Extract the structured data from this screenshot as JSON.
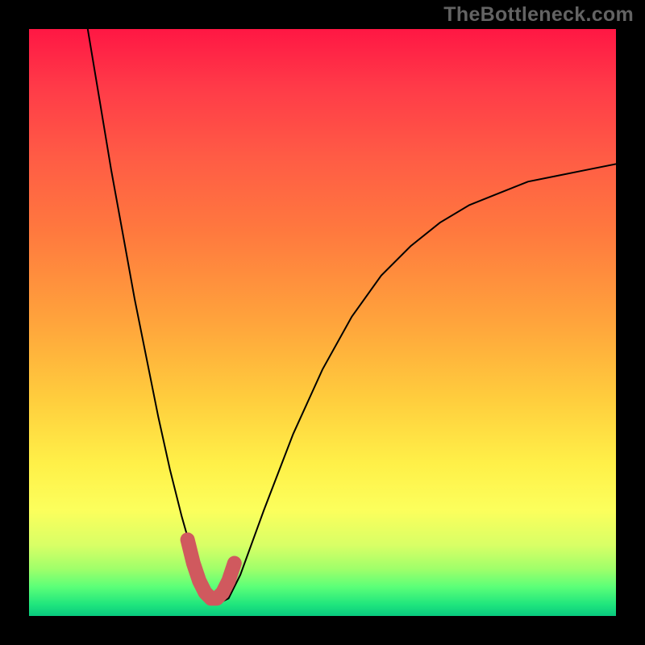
{
  "watermark": "TheBottleneck.com",
  "chart_data": {
    "type": "line",
    "title": "",
    "xlabel": "",
    "ylabel": "",
    "xlim": [
      0,
      100
    ],
    "ylim": [
      0,
      100
    ],
    "series": [
      {
        "name": "black-curve",
        "x": [
          10,
          12,
          14,
          16,
          18,
          20,
          22,
          24,
          26,
          28,
          30,
          32,
          34,
          36,
          40,
          45,
          50,
          55,
          60,
          65,
          70,
          75,
          80,
          85,
          90,
          95,
          100
        ],
        "y": [
          100,
          88,
          76,
          65,
          54,
          44,
          34,
          25,
          17,
          10,
          5,
          2,
          3,
          7,
          18,
          31,
          42,
          51,
          58,
          63,
          67,
          70,
          72,
          74,
          75,
          76,
          77
        ]
      },
      {
        "name": "red-thick-segment",
        "x": [
          27,
          28,
          29,
          30,
          31,
          32,
          33,
          34,
          35
        ],
        "y": [
          13,
          9,
          6,
          4,
          3,
          3,
          4,
          6,
          9
        ]
      }
    ],
    "gradient_stops_top_to_bottom": [
      "#ff1744",
      "#ff7a3e",
      "#ffcd3d",
      "#fcff5c",
      "#5cff78",
      "#08c97e"
    ],
    "colors": {
      "curve": "#000000",
      "thick_segment": "#d0595e",
      "background_frame": "#000000",
      "watermark": "#636363"
    }
  }
}
